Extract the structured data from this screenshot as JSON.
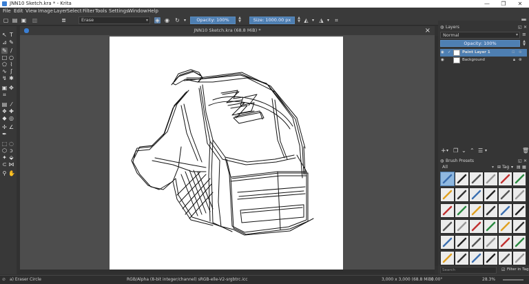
{
  "window": {
    "title": "JNN10 Sketch.kra * - Krita",
    "minimize": "—",
    "maximize": "❐",
    "close": "✕"
  },
  "menu": [
    "File",
    "Edit",
    "View",
    "Image",
    "Layer",
    "Select",
    "Filter",
    "Tools",
    "Settings",
    "Window",
    "Help"
  ],
  "toolbar": {
    "blend_mode": "Erase",
    "opacity_label": "Opacity: 100%",
    "size_label": "Size: 1000.00 px"
  },
  "document": {
    "tab_title": "JNN10 Sketch.kra (68.8 MiB) *"
  },
  "layers_docker": {
    "title": "Layers",
    "blend_mode": "Normal",
    "opacity_label": "Opacity:  100%",
    "layers": [
      {
        "name": "Paint Layer 1",
        "selected": true
      },
      {
        "name": "Background",
        "selected": false
      }
    ]
  },
  "brush_presets": {
    "title": "Brush Presets",
    "filter": "All",
    "tag_label": "Tag",
    "search_placeholder": "Search",
    "filter_in_tag": "Filter in Tag"
  },
  "status": {
    "brush": "a) Eraser Circle",
    "color_info": "RGB/Alpha (8-bit integer/channel)  sRGB-elle-V2-srgbtrc.icc",
    "image_info": "3,000 x 3,000 (68.8 MiB)",
    "zoom": "28.3%",
    "rotation": "0.00°"
  },
  "colors": {
    "accent": "#4e7fb2",
    "bg": "#313131",
    "canvas_bg": "#4d4d4d"
  }
}
